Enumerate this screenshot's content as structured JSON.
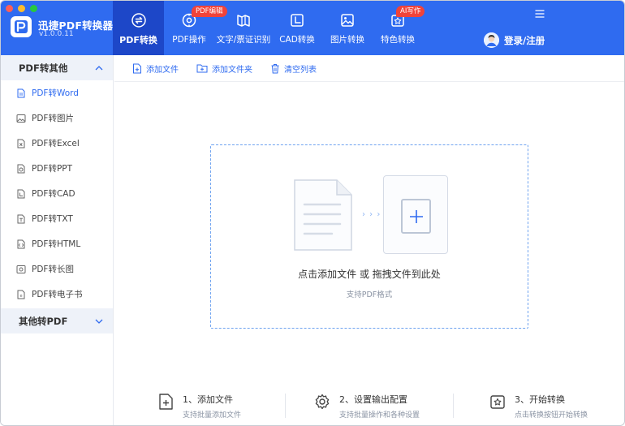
{
  "app": {
    "title": "迅捷PDF转换器",
    "version": "v1.0.0.11",
    "brand_color": "#2f6bf0"
  },
  "nav": {
    "items": [
      {
        "label": "PDF转换",
        "icon": "convert-icon",
        "active": true
      },
      {
        "label": "PDF操作",
        "icon": "pdf-ops-icon",
        "badge": "PDF编辑"
      },
      {
        "label": "文字/票证识别",
        "icon": "ocr-icon"
      },
      {
        "label": "CAD转换",
        "icon": "cad-icon"
      },
      {
        "label": "图片转换",
        "icon": "image-icon"
      },
      {
        "label": "特色转换",
        "icon": "special-icon",
        "badge": "AI写作"
      }
    ],
    "login_label": "登录/注册"
  },
  "sidebar": {
    "group1": "PDF转其他",
    "items": [
      {
        "label": "PDF转Word",
        "icon": "word-file-icon",
        "active": true
      },
      {
        "label": "PDF转图片",
        "icon": "image-file-icon"
      },
      {
        "label": "PDF转Excel",
        "icon": "excel-file-icon"
      },
      {
        "label": "PDF转PPT",
        "icon": "ppt-file-icon"
      },
      {
        "label": "PDF转CAD",
        "icon": "cad-file-icon"
      },
      {
        "label": "PDF转TXT",
        "icon": "txt-file-icon"
      },
      {
        "label": "PDF转HTML",
        "icon": "html-file-icon"
      },
      {
        "label": "PDF转长图",
        "icon": "long-image-icon"
      },
      {
        "label": "PDF转电子书",
        "icon": "ebook-icon"
      }
    ],
    "group2": "其他转PDF"
  },
  "toolbar": {
    "add_file": "添加文件",
    "add_folder": "添加文件夹",
    "clear_list": "清空列表"
  },
  "dropzone": {
    "main": "点击添加文件 或 拖拽文件到此处",
    "sub": "支持PDF格式",
    "arrows": "› › ›"
  },
  "steps": [
    {
      "title": "1、添加文件",
      "sub": "支持批量添加文件",
      "icon": "add-file-icon"
    },
    {
      "title": "2、设置输出配置",
      "sub": "支持批量操作和各种设置",
      "icon": "settings-gear-icon"
    },
    {
      "title": "3、开始转换",
      "sub": "点击转换按钮开始转换",
      "icon": "start-convert-icon"
    }
  ]
}
